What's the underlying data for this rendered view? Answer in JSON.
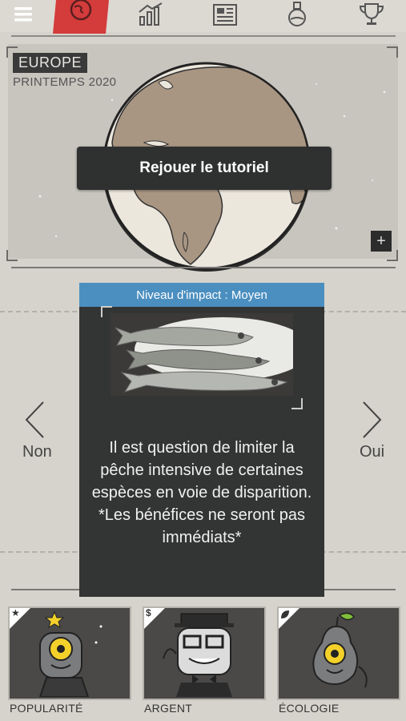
{
  "nav": {
    "icons": [
      "menu-icon",
      "globe-icon",
      "bar-chart-icon",
      "newspaper-icon",
      "flask-icon",
      "trophy-icon"
    ],
    "active_color": "#d43b3b"
  },
  "map": {
    "region": "EUROPE",
    "season": "PRINTEMPS 2020",
    "replay_label": "Rejouer le tutoriel",
    "expand_label": "+"
  },
  "card": {
    "impact_label": "Niveau d'impact : Moyen",
    "header_color": "#4b8fc0",
    "text": "Il est question de limiter la pêche intensive de certaines espèces en voie de disparition. *Les bénéfices ne seront pas immédiats*"
  },
  "choices": {
    "left_label": "Non",
    "right_label": "Oui"
  },
  "stats": [
    {
      "label": "POPULARITÉ",
      "icon": "star-icon"
    },
    {
      "label": "ARGENT",
      "icon": "dollar-icon"
    },
    {
      "label": "ÉCOLOGIE",
      "icon": "leaf-icon"
    }
  ]
}
